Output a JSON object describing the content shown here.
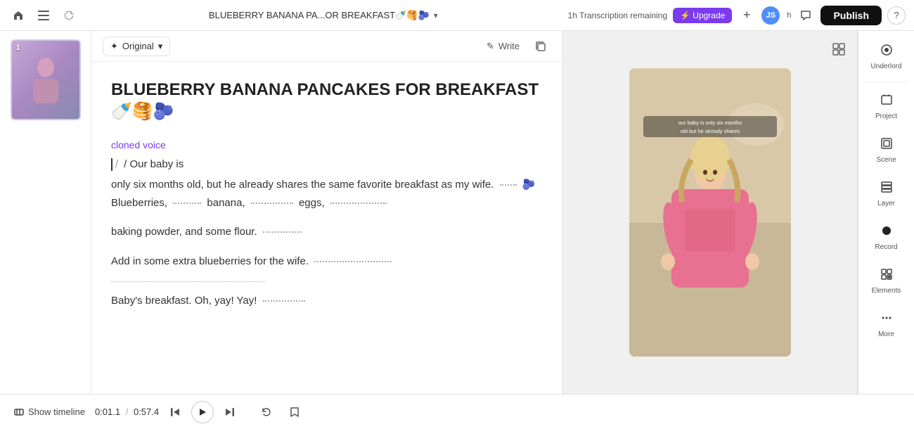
{
  "topbar": {
    "project_title": "BLUEBERRY BANANA PA...OR BREAKFAST🍼🥞🫐",
    "transcription_label": "1h  Transcription remaining",
    "upgrade_label": "⚡ Upgrade",
    "plus_label": "+",
    "user_initial": "h",
    "publish_label": "Publish",
    "help_label": "?"
  },
  "editor": {
    "original_label": "Original",
    "write_label": "Write",
    "title": "BLUEBERRY BANANA PANCAKES FOR BREAKFAST🍼🥞🫐",
    "cloned_voice_label": "cloned voice",
    "cursor_text": "/  Our baby is",
    "paragraph1": "only six months old, but he already shares the same favorite breakfast as my wife.",
    "blueberries": "🫐 Blueberries,",
    "banana": "banana,",
    "eggs": "eggs,",
    "paragraph2": "baking powder, and some flour.",
    "paragraph3": "Add in some extra blueberries for the wife.",
    "paragraph4": "Baby's breakfast. Oh, yay! Yay!"
  },
  "preview": {
    "overlay_text": "our baby is only six months old but he already shares"
  },
  "sidebar": {
    "items": [
      {
        "label": "Underlord",
        "icon": "🏠"
      },
      {
        "label": "Project",
        "icon": "📁"
      },
      {
        "label": "Scene",
        "icon": "⬜"
      },
      {
        "label": "Layer",
        "icon": "🔲"
      },
      {
        "label": "Record",
        "icon": "⏺"
      },
      {
        "label": "Elements",
        "icon": "⊞"
      },
      {
        "label": "More",
        "icon": "⋯"
      }
    ]
  },
  "bottombar": {
    "show_timeline_label": "Show timeline",
    "current_time": "0:01.1",
    "separator": "/",
    "total_time": "0:57.4"
  },
  "thumbnail": {
    "number": "1"
  }
}
